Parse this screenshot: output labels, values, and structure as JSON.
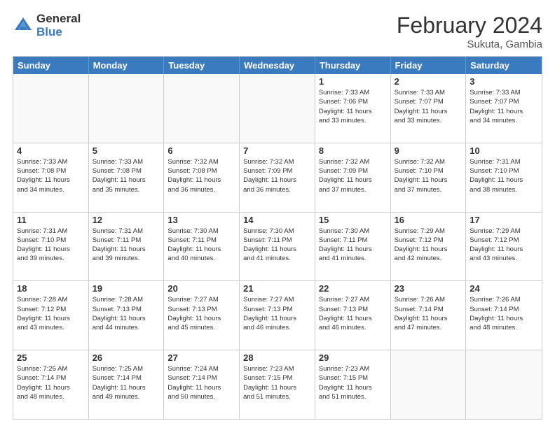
{
  "header": {
    "logo_general": "General",
    "logo_blue": "Blue",
    "title": "February 2024",
    "location": "Sukuta, Gambia"
  },
  "days_of_week": [
    "Sunday",
    "Monday",
    "Tuesday",
    "Wednesday",
    "Thursday",
    "Friday",
    "Saturday"
  ],
  "weeks": [
    [
      {
        "day": "",
        "info": ""
      },
      {
        "day": "",
        "info": ""
      },
      {
        "day": "",
        "info": ""
      },
      {
        "day": "",
        "info": ""
      },
      {
        "day": "1",
        "info": "Sunrise: 7:33 AM\nSunset: 7:06 PM\nDaylight: 11 hours\nand 33 minutes."
      },
      {
        "day": "2",
        "info": "Sunrise: 7:33 AM\nSunset: 7:07 PM\nDaylight: 11 hours\nand 33 minutes."
      },
      {
        "day": "3",
        "info": "Sunrise: 7:33 AM\nSunset: 7:07 PM\nDaylight: 11 hours\nand 34 minutes."
      }
    ],
    [
      {
        "day": "4",
        "info": "Sunrise: 7:33 AM\nSunset: 7:08 PM\nDaylight: 11 hours\nand 34 minutes."
      },
      {
        "day": "5",
        "info": "Sunrise: 7:33 AM\nSunset: 7:08 PM\nDaylight: 11 hours\nand 35 minutes."
      },
      {
        "day": "6",
        "info": "Sunrise: 7:32 AM\nSunset: 7:08 PM\nDaylight: 11 hours\nand 36 minutes."
      },
      {
        "day": "7",
        "info": "Sunrise: 7:32 AM\nSunset: 7:09 PM\nDaylight: 11 hours\nand 36 minutes."
      },
      {
        "day": "8",
        "info": "Sunrise: 7:32 AM\nSunset: 7:09 PM\nDaylight: 11 hours\nand 37 minutes."
      },
      {
        "day": "9",
        "info": "Sunrise: 7:32 AM\nSunset: 7:10 PM\nDaylight: 11 hours\nand 37 minutes."
      },
      {
        "day": "10",
        "info": "Sunrise: 7:31 AM\nSunset: 7:10 PM\nDaylight: 11 hours\nand 38 minutes."
      }
    ],
    [
      {
        "day": "11",
        "info": "Sunrise: 7:31 AM\nSunset: 7:10 PM\nDaylight: 11 hours\nand 39 minutes."
      },
      {
        "day": "12",
        "info": "Sunrise: 7:31 AM\nSunset: 7:11 PM\nDaylight: 11 hours\nand 39 minutes."
      },
      {
        "day": "13",
        "info": "Sunrise: 7:30 AM\nSunset: 7:11 PM\nDaylight: 11 hours\nand 40 minutes."
      },
      {
        "day": "14",
        "info": "Sunrise: 7:30 AM\nSunset: 7:11 PM\nDaylight: 11 hours\nand 41 minutes."
      },
      {
        "day": "15",
        "info": "Sunrise: 7:30 AM\nSunset: 7:11 PM\nDaylight: 11 hours\nand 41 minutes."
      },
      {
        "day": "16",
        "info": "Sunrise: 7:29 AM\nSunset: 7:12 PM\nDaylight: 11 hours\nand 42 minutes."
      },
      {
        "day": "17",
        "info": "Sunrise: 7:29 AM\nSunset: 7:12 PM\nDaylight: 11 hours\nand 43 minutes."
      }
    ],
    [
      {
        "day": "18",
        "info": "Sunrise: 7:28 AM\nSunset: 7:12 PM\nDaylight: 11 hours\nand 43 minutes."
      },
      {
        "day": "19",
        "info": "Sunrise: 7:28 AM\nSunset: 7:13 PM\nDaylight: 11 hours\nand 44 minutes."
      },
      {
        "day": "20",
        "info": "Sunrise: 7:27 AM\nSunset: 7:13 PM\nDaylight: 11 hours\nand 45 minutes."
      },
      {
        "day": "21",
        "info": "Sunrise: 7:27 AM\nSunset: 7:13 PM\nDaylight: 11 hours\nand 46 minutes."
      },
      {
        "day": "22",
        "info": "Sunrise: 7:27 AM\nSunset: 7:13 PM\nDaylight: 11 hours\nand 46 minutes."
      },
      {
        "day": "23",
        "info": "Sunrise: 7:26 AM\nSunset: 7:14 PM\nDaylight: 11 hours\nand 47 minutes."
      },
      {
        "day": "24",
        "info": "Sunrise: 7:26 AM\nSunset: 7:14 PM\nDaylight: 11 hours\nand 48 minutes."
      }
    ],
    [
      {
        "day": "25",
        "info": "Sunrise: 7:25 AM\nSunset: 7:14 PM\nDaylight: 11 hours\nand 48 minutes."
      },
      {
        "day": "26",
        "info": "Sunrise: 7:25 AM\nSunset: 7:14 PM\nDaylight: 11 hours\nand 49 minutes."
      },
      {
        "day": "27",
        "info": "Sunrise: 7:24 AM\nSunset: 7:14 PM\nDaylight: 11 hours\nand 50 minutes."
      },
      {
        "day": "28",
        "info": "Sunrise: 7:23 AM\nSunset: 7:15 PM\nDaylight: 11 hours\nand 51 minutes."
      },
      {
        "day": "29",
        "info": "Sunrise: 7:23 AM\nSunset: 7:15 PM\nDaylight: 11 hours\nand 51 minutes."
      },
      {
        "day": "",
        "info": ""
      },
      {
        "day": "",
        "info": ""
      }
    ]
  ]
}
